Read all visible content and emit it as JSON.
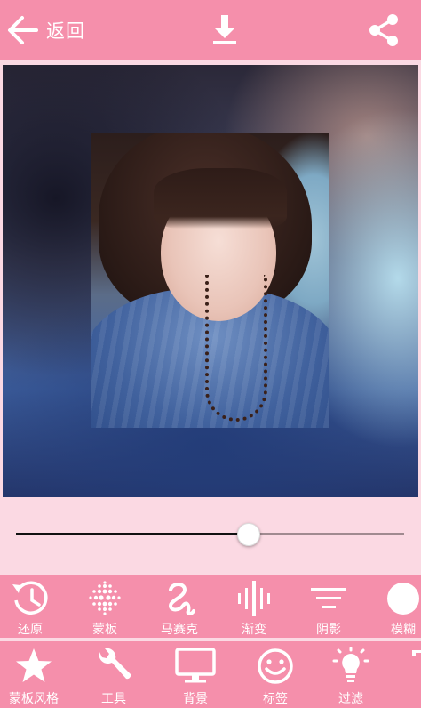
{
  "header": {
    "back_label": "返回",
    "back_icon": "arrow-left-icon",
    "download_icon": "download-icon",
    "share_icon": "share-icon"
  },
  "slider": {
    "value": 0.6
  },
  "toolbar_primary": [
    {
      "label": "还原",
      "icon": "restore-history-icon"
    },
    {
      "label": "蒙板",
      "icon": "mask-dots-icon"
    },
    {
      "label": "马赛克",
      "icon": "mosaic-squiggle-icon"
    },
    {
      "label": "渐变",
      "icon": "gradient-bars-icon"
    },
    {
      "label": "阴影",
      "icon": "shadow-lines-icon"
    },
    {
      "label": "模糊",
      "icon": "blur-circle-icon"
    }
  ],
  "toolbar_secondary": [
    {
      "label": "蒙板风格",
      "icon": "star-icon"
    },
    {
      "label": "工具",
      "icon": "wrench-icon"
    },
    {
      "label": "背景",
      "icon": "monitor-icon"
    },
    {
      "label": "标签",
      "icon": "smiley-icon"
    },
    {
      "label": "过滤",
      "icon": "lightbulb-icon"
    }
  ],
  "colors": {
    "accent": "#f58fab",
    "background": "#fbd9e3"
  }
}
